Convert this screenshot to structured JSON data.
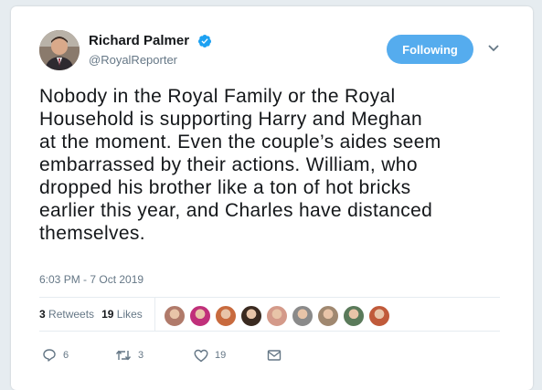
{
  "user": {
    "name": "Richard Palmer",
    "handle": "@RoyalReporter",
    "verified": true
  },
  "follow_button_label": "Following",
  "tweet": {
    "lines": [
      "Nobody in the Royal Family or the Royal",
      "Household is supporting Harry and Meghan",
      "at the moment. Even the couple’s aides seem",
      "embarrassed by their actions. William, who",
      "dropped his brother like a ton of hot bricks",
      "earlier this year, and Charles have distanced",
      "themselves."
    ],
    "timestamp": "6:03 PM - 7 Oct 2019"
  },
  "stats": {
    "retweets_count": "3",
    "retweets_label": "Retweets",
    "likes_count": "19",
    "likes_label": "Likes"
  },
  "likers": [
    {
      "icon": "liker-avatar-1",
      "color": "#b07a6a"
    },
    {
      "icon": "liker-avatar-2",
      "color": "#c0307a"
    },
    {
      "icon": "liker-avatar-3",
      "color": "#c86a3e"
    },
    {
      "icon": "liker-avatar-4",
      "color": "#3a2a20"
    },
    {
      "icon": "liker-avatar-5",
      "color": "#d49a8a"
    },
    {
      "icon": "liker-avatar-6",
      "color": "#8a8a8a"
    },
    {
      "icon": "liker-avatar-7",
      "color": "#a08870"
    },
    {
      "icon": "liker-avatar-8",
      "color": "#5a7a5a"
    },
    {
      "icon": "liker-avatar-9",
      "color": "#c05a3a"
    }
  ],
  "actions": {
    "reply_count": "6",
    "retweet_count": "3",
    "like_count": "19"
  },
  "colors": {
    "accent": "#55acee",
    "text": "#14171a",
    "muted": "#657786"
  }
}
